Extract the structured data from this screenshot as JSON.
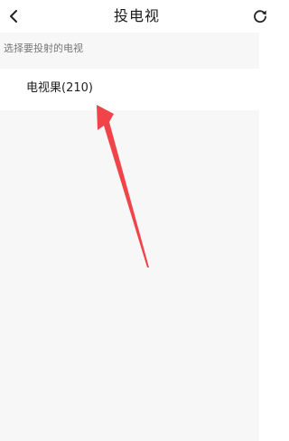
{
  "header": {
    "title": "投电视",
    "back_icon": "chevron-left-icon",
    "refresh_icon": "refresh-icon"
  },
  "section": {
    "label": "选择要投射的电视"
  },
  "devices": [
    {
      "name": "电视果(210)"
    }
  ],
  "colors": {
    "annotation_arrow": "#f0444a",
    "content_background": "#f7f7f7"
  }
}
